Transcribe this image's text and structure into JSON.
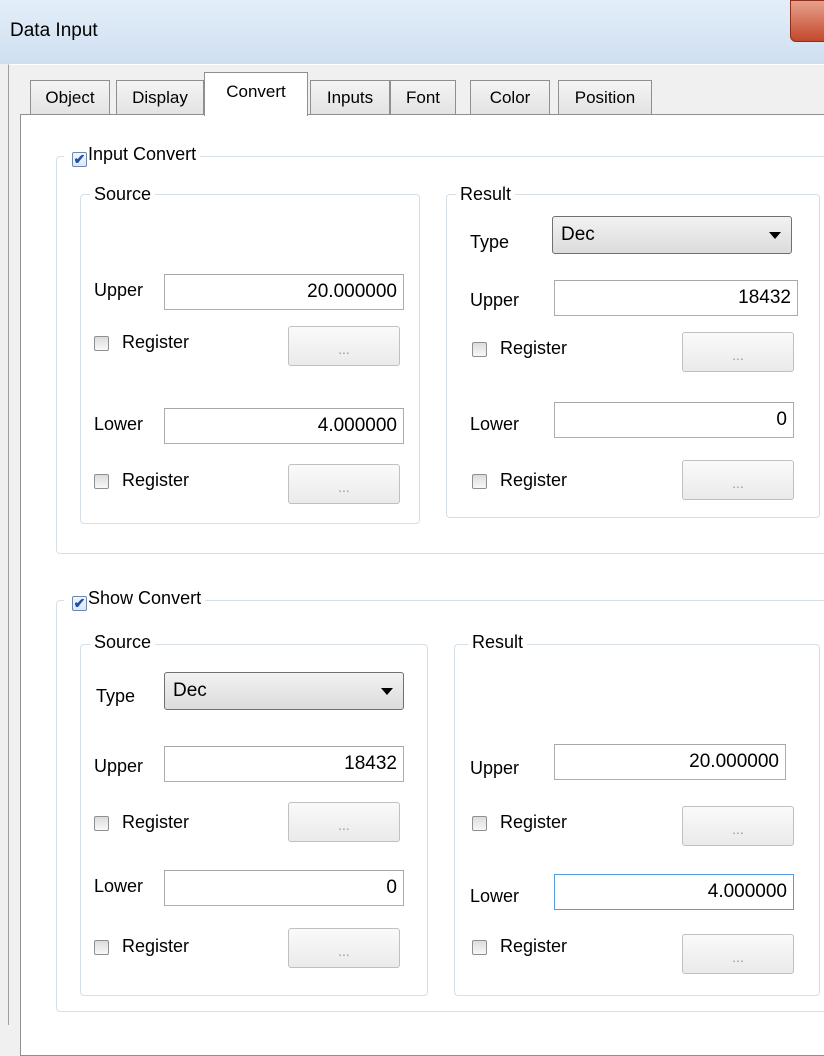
{
  "window": {
    "title": "Data Input"
  },
  "tabs": [
    "Object",
    "Display",
    "Convert",
    "Inputs",
    "Font",
    "Color",
    "Position"
  ],
  "active_tab": "Convert",
  "input_convert": {
    "label": "Input Convert",
    "checked": true,
    "source": {
      "title": "Source",
      "upper_label": "Upper",
      "upper_value": "20.000000",
      "upper_register_label": "Register",
      "lower_label": "Lower",
      "lower_value": "4.000000",
      "lower_register_label": "Register",
      "browse_label": "..."
    },
    "result": {
      "title": "Result",
      "type_label": "Type",
      "type_value": "Dec",
      "upper_label": "Upper",
      "upper_value": "18432",
      "upper_register_label": "Register",
      "lower_label": "Lower",
      "lower_value": "0",
      "lower_register_label": "Register",
      "browse_label": "..."
    }
  },
  "show_convert": {
    "label": "Show Convert",
    "checked": true,
    "source": {
      "title": "Source",
      "type_label": "Type",
      "type_value": "Dec",
      "upper_label": "Upper",
      "upper_value": "18432",
      "upper_register_label": "Register",
      "lower_label": "Lower",
      "lower_value": "0",
      "lower_register_label": "Register",
      "browse_label": "..."
    },
    "result": {
      "title": "Result",
      "upper_label": "Upper",
      "upper_value": "20.000000",
      "upper_register_label": "Register",
      "lower_label": "Lower",
      "lower_value": "4.000000",
      "lower_register_label": "Register",
      "browse_label": "..."
    }
  }
}
